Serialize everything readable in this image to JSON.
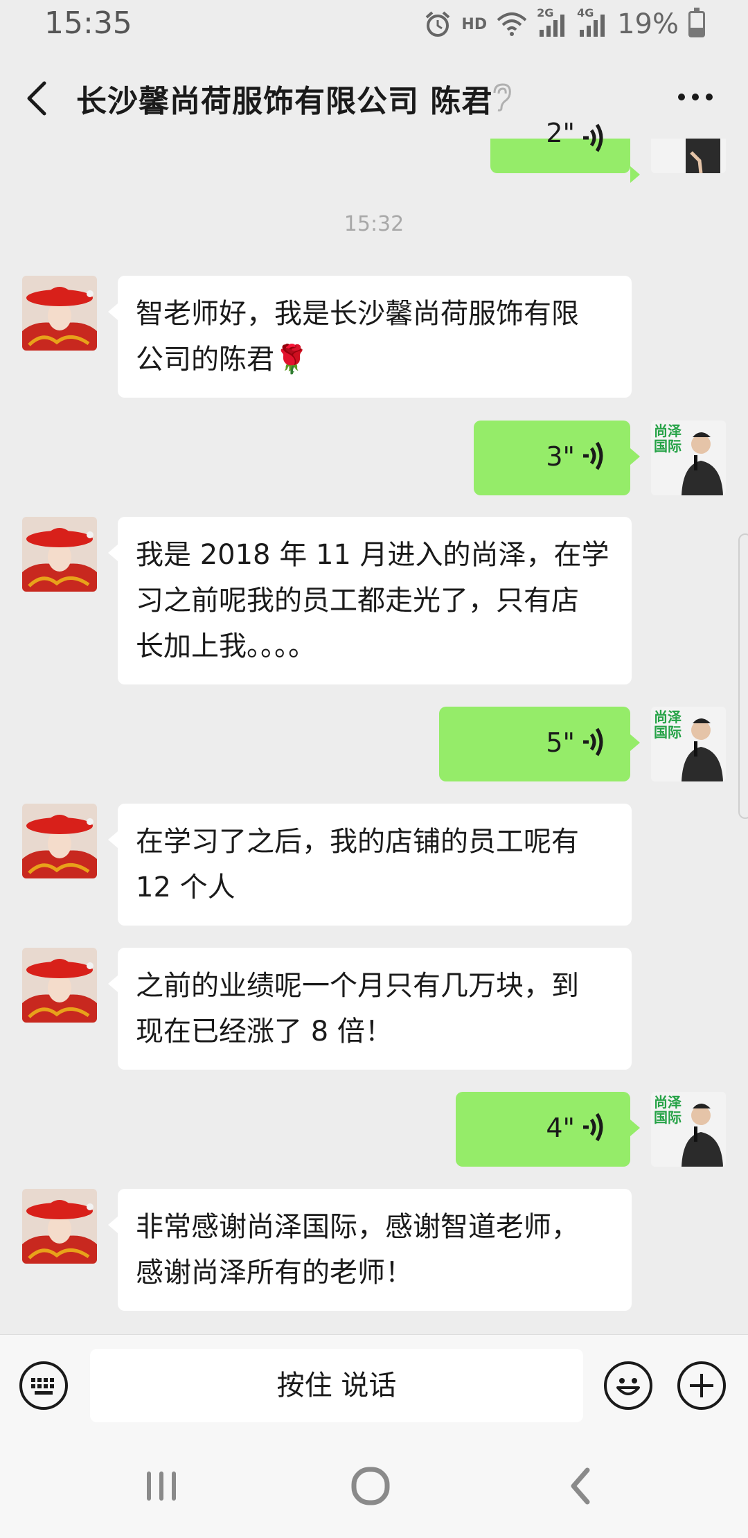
{
  "status_bar": {
    "time": "15:35",
    "hd_label": "HD",
    "network_2g": "2G",
    "network_4g": "4G",
    "battery": "19%"
  },
  "header": {
    "title": "长沙馨尚荷服饰有限公司 陈君"
  },
  "timestamp": "15:32",
  "messages": [
    {
      "side": "out",
      "duration": "2\""
    },
    {
      "side": "in",
      "text_lines": [
        "智老师好，我是长沙馨尚荷服饰有限",
        "公司的陈君🌹"
      ]
    },
    {
      "side": "out",
      "duration": "3\""
    },
    {
      "side": "in",
      "text_lines": [
        "我是 2018 年 11 月进入的尚泽，在学",
        "习之前呢我的员工都走光了，只有店",
        "长加上我。。。。"
      ]
    },
    {
      "side": "out",
      "duration": "5\""
    },
    {
      "side": "in",
      "text_lines": [
        "在学习了之后，我的店铺的员工呢有",
        "12 个人"
      ]
    },
    {
      "side": "in",
      "text_lines": [
        "之前的业绩呢一个月只有几万块，到",
        "现在已经涨了 8 倍！"
      ]
    },
    {
      "side": "out",
      "duration": "4\""
    },
    {
      "side": "in",
      "text_lines": [
        "非常感谢尚泽国际，感谢智道老师，",
        "感谢尚泽所有的老师！"
      ]
    }
  ],
  "avatar_logo_text": [
    "尚泽",
    "国际"
  ],
  "input": {
    "hold_to_talk": "按住 说话"
  },
  "colors": {
    "background": "#ededed",
    "bubble_out": "#95ec69",
    "bubble_in": "#ffffff"
  }
}
